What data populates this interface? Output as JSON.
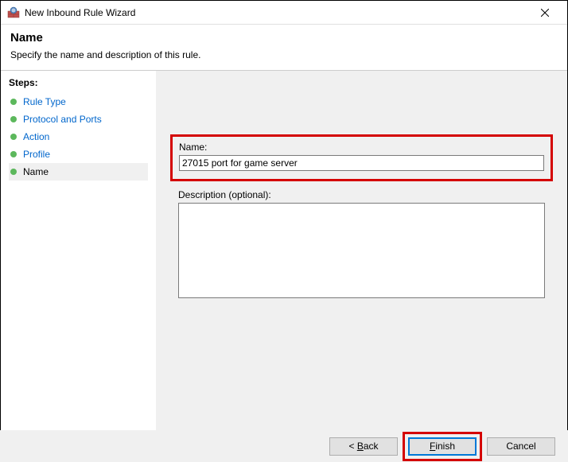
{
  "window": {
    "title": "New Inbound Rule Wizard"
  },
  "header": {
    "title": "Name",
    "subtitle": "Specify the name and description of this rule."
  },
  "sidebar": {
    "title": "Steps:",
    "items": [
      {
        "label": "Rule Type",
        "state": "done"
      },
      {
        "label": "Protocol and Ports",
        "state": "done"
      },
      {
        "label": "Action",
        "state": "done"
      },
      {
        "label": "Profile",
        "state": "done"
      },
      {
        "label": "Name",
        "state": "current"
      }
    ]
  },
  "form": {
    "name_label": "Name:",
    "name_value": "27015 port for game server",
    "description_label": "Description (optional):",
    "description_value": ""
  },
  "buttons": {
    "back_prefix": "< ",
    "back_u": "B",
    "back_rest": "ack",
    "finish_u": "F",
    "finish_rest": "inish",
    "cancel": "Cancel"
  }
}
